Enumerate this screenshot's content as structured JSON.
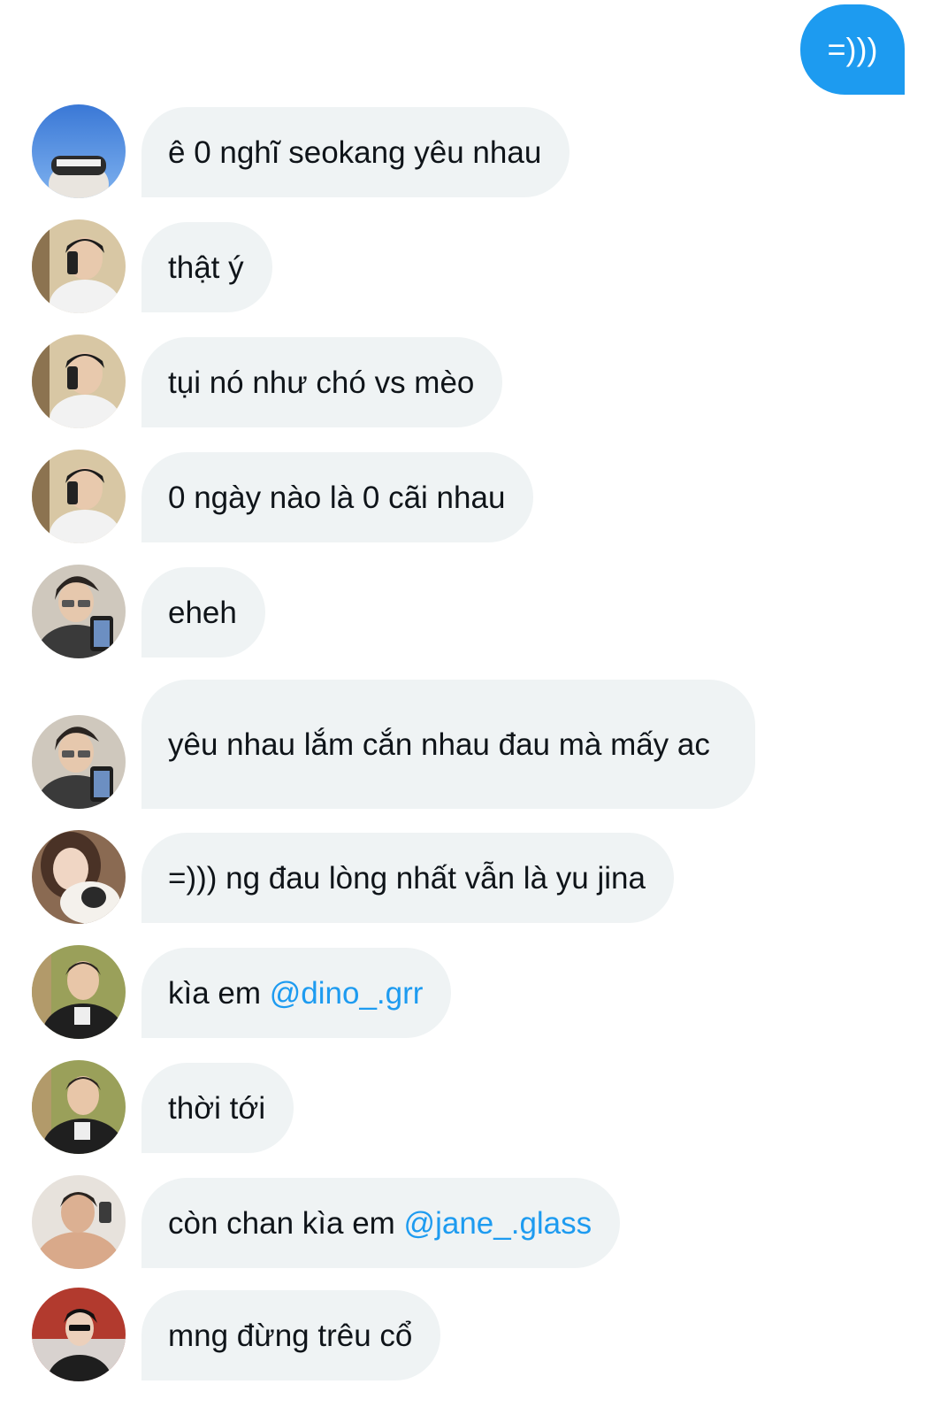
{
  "conversation": {
    "sent_message": {
      "text": "=)))"
    },
    "messages": [
      {
        "avatar": "avatar-blue-sky",
        "text": "ê 0 nghĩ seokang yêu nhau"
      },
      {
        "avatar": "avatar-mirror-selfie",
        "text": "thật ý"
      },
      {
        "avatar": "avatar-mirror-selfie",
        "text": "tụi nó như chó vs mèo"
      },
      {
        "avatar": "avatar-mirror-selfie",
        "text": "0 ngày nào là 0 cãi nhau"
      },
      {
        "avatar": "avatar-glasses-phone",
        "text": "eheh"
      },
      {
        "avatar": "avatar-glasses-phone",
        "text": "yêu nhau lắm cắn nhau đau mà mấy ac"
      },
      {
        "avatar": "avatar-girl-cat",
        "text": "=))) ng đau lòng nhất vẫn là yu jina"
      },
      {
        "avatar": "avatar-jacket-green",
        "text_prefix": "kìa em ",
        "mention": "@dino_.grr"
      },
      {
        "avatar": "avatar-jacket-green",
        "text": "thời tới"
      },
      {
        "avatar": "avatar-shirtless",
        "text_prefix": "còn chan kìa em ",
        "mention": "@jane_.glass"
      },
      {
        "avatar": "avatar-red-bg",
        "text": "mng đừng trêu cổ"
      }
    ]
  },
  "colors": {
    "sent_bubble": "#1d9bf0",
    "received_bubble": "#eff3f4",
    "mention": "#1d9bf0",
    "text": "#0f1419"
  }
}
